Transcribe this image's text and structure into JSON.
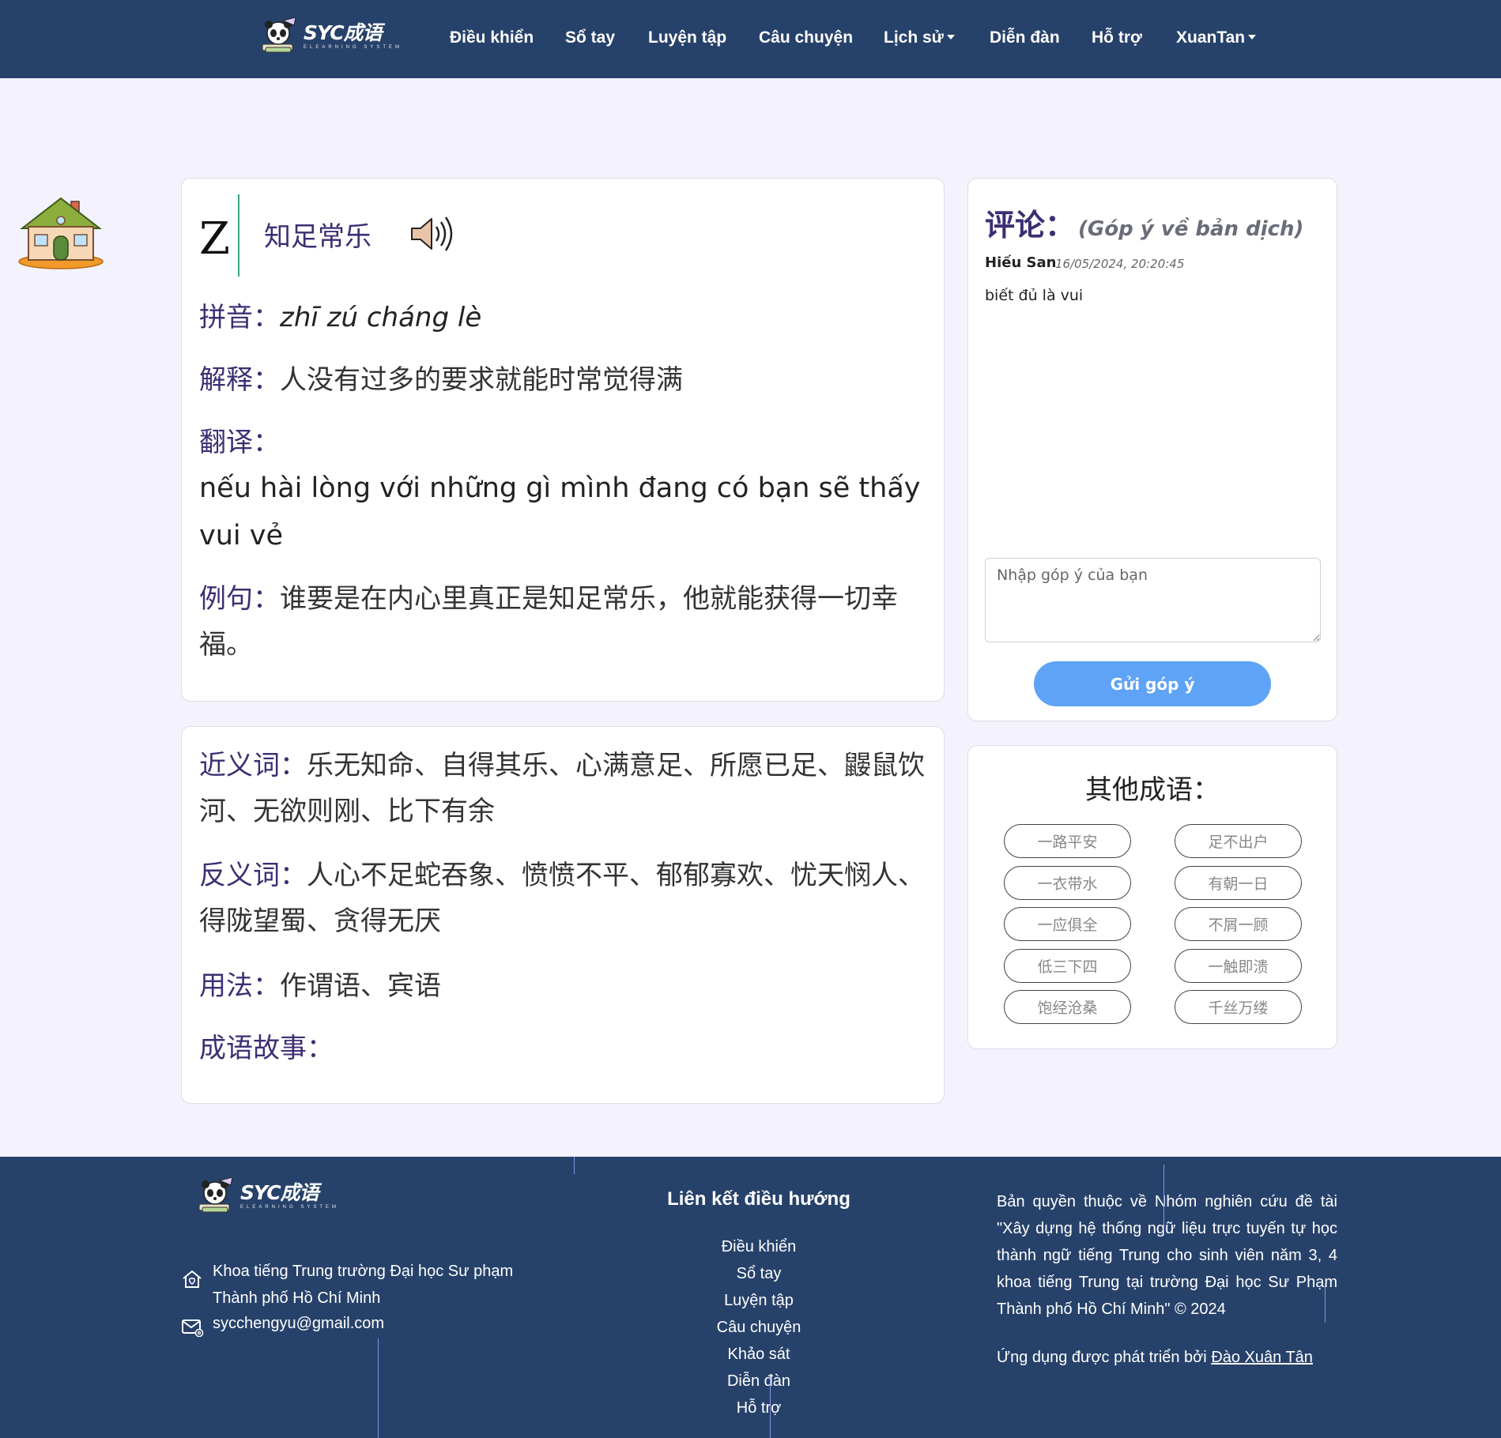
{
  "nav": {
    "logo_text": "SYC成语",
    "logo_sub": "ELEARNING SYSTEM",
    "items": [
      {
        "label": "Điều khiển"
      },
      {
        "label": "Sổ tay"
      },
      {
        "label": "Luyện tập"
      },
      {
        "label": "Câu chuyện"
      },
      {
        "label": "Lịch sử"
      },
      {
        "label": "Diễn đàn"
      },
      {
        "label": "Hỗ trợ"
      },
      {
        "label": "XuanTan"
      }
    ]
  },
  "idiom": {
    "letter": "Z",
    "title": "知足常乐",
    "pinyin_label": "拼音：",
    "pinyin": "zhī zú cháng lè",
    "explain_label": "解释：",
    "explain": "人没有过多的要求就能时常觉得满",
    "translate_label": "翻译：",
    "translate": "nếu hài lòng với những gì mình đang có bạn sẽ thấy vui vẻ",
    "example_label": "例句：",
    "example": "谁要是在内心里真正是知足常乐，他就能获得一切幸福。",
    "synonym_label": "近义词：",
    "synonym": "乐无知命、自得其乐、心满意足、所愿已足、鼹鼠饮河、无欲则刚、比下有余",
    "antonym_label": "反义词：",
    "antonym": "人心不足蛇吞象、愤愤不平、郁郁寡欢、忧天悯人、得陇望蜀、贪得无厌",
    "usage_label": "用法：",
    "usage": "作谓语、宾语",
    "story_label": "成语故事："
  },
  "comments": {
    "title": "评论：",
    "subtitle": "(Góp ý về bản dịch)",
    "items": [
      {
        "user": "Hiếu San",
        "time": "16/05/2024, 20:20:45",
        "text": "biết đủ là vui"
      }
    ],
    "input_placeholder": "Nhập góp ý của bạn",
    "send_label": "Gửi góp ý"
  },
  "other": {
    "title": "其他成语：",
    "items": [
      "一路平安",
      "足不出户",
      "一衣带水",
      "有朝一日",
      "一应俱全",
      "不屑一顾",
      "低三下四",
      "一触即溃",
      "饱经沧桑",
      "千丝万缕"
    ]
  },
  "footer": {
    "address": "Khoa tiếng Trung trường Đại học Sư phạm Thành phố Hồ Chí Minh",
    "email": "sycchengyu@gmail.com",
    "links_title": "Liên kết điều hướng",
    "links": [
      "Điều khiển",
      "Sổ tay",
      "Luyện tập",
      "Câu chuyện",
      "Khảo sát",
      "Diễn đàn",
      "Hỗ trợ"
    ],
    "copyright": "Bản quyền thuộc về Nhóm nghiên cứu đề tài \"Xây dựng hệ thống ngữ liệu trực tuyến tự học thành ngữ tiếng Trung cho sinh viên năm 3, 4 khoa tiếng Trung tại trường Đại học Sư Phạm Thành phố Hồ Chí Minh\" © 2024",
    "dev_prefix": "Ứng dụng được phát triển bởi ",
    "dev_name": "Đào Xuân Tân"
  },
  "colors": {
    "navbar": "#27426a",
    "accent_purple": "#3d2e73",
    "send_button": "#5ea3f5",
    "divider_green": "#3aa67d",
    "page_bg": "#f4f3fd"
  }
}
